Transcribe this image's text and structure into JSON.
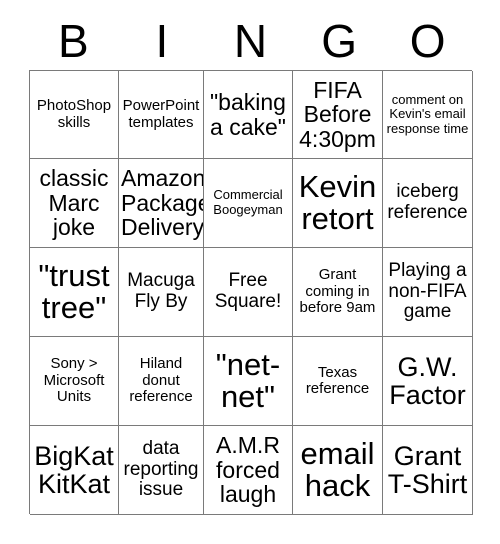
{
  "card": {
    "header_letters": [
      "B",
      "I",
      "N",
      "G",
      "O"
    ],
    "grid": {
      "rows": 5,
      "columns": 5,
      "border_color": "#7a7a7a",
      "background_color": "#ffffff",
      "text_color": "#000000"
    },
    "cells": [
      {
        "text": "PhotoShop skills",
        "size": "sz-s"
      },
      {
        "text": "PowerPoint templates",
        "size": "sz-s"
      },
      {
        "text": "\"baking a cake\"",
        "size": "sz-l"
      },
      {
        "text": "FIFA Before 4:30pm",
        "size": "sz-l"
      },
      {
        "text": "comment on Kevin's email response time",
        "size": "sz-xs"
      },
      {
        "text": "classic Marc joke",
        "size": "sz-l"
      },
      {
        "text": "Amazon Package Delivery",
        "size": "sz-l"
      },
      {
        "text": "Commercial Boogeyman",
        "size": "sz-xs"
      },
      {
        "text": "Kevin retort",
        "size": "sz-xxl"
      },
      {
        "text": "iceberg reference",
        "size": "sz-m"
      },
      {
        "text": "\"trust tree\"",
        "size": "sz-xxl"
      },
      {
        "text": "Macuga Fly By",
        "size": "sz-m"
      },
      {
        "text": "Free Square!",
        "size": "sz-m"
      },
      {
        "text": "Grant coming in before 9am",
        "size": "sz-s"
      },
      {
        "text": "Playing a non-FIFA game",
        "size": "sz-m"
      },
      {
        "text": "Sony > Microsoft Units",
        "size": "sz-s"
      },
      {
        "text": "Hiland donut reference",
        "size": "sz-s"
      },
      {
        "text": "\"net-net\"",
        "size": "sz-xxl"
      },
      {
        "text": "Texas reference",
        "size": "sz-s"
      },
      {
        "text": "G.W. Factor",
        "size": "sz-xl"
      },
      {
        "text": "BigKat KitKat",
        "size": "sz-xl"
      },
      {
        "text": "data reporting issue",
        "size": "sz-m"
      },
      {
        "text": "A.M.R forced laugh",
        "size": "sz-l"
      },
      {
        "text": "email hack",
        "size": "sz-xxl"
      },
      {
        "text": "Grant T-Shirt",
        "size": "sz-xl"
      }
    ]
  }
}
